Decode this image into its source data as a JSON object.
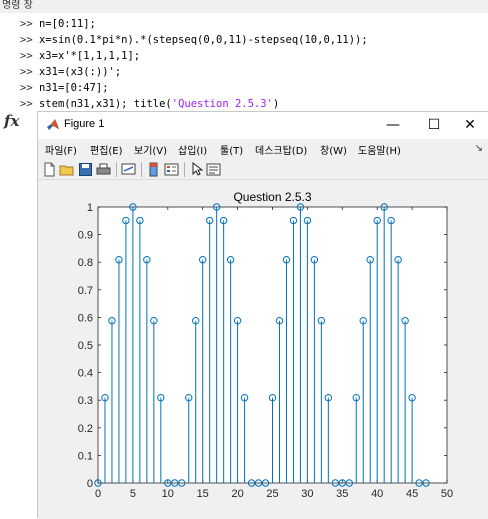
{
  "command_window": {
    "title": "명령 창",
    "prompt": ">>",
    "lines": [
      {
        "code": "n=[0:11];",
        "str": "",
        "tail": ""
      },
      {
        "code": "x=sin(0.1*pi*n).*(stepseq(0,0,11)-stepseq(10,0,11));",
        "str": "",
        "tail": ""
      },
      {
        "code": "x3=x'*[1,1,1,1];",
        "str": "",
        "tail": ""
      },
      {
        "code": "x31=(x3(:))';",
        "str": "",
        "tail": ""
      },
      {
        "code": "n31=[0:47];",
        "str": "",
        "tail": ""
      },
      {
        "code": "stem(n31,x31); title(",
        "str": "'Question 2.5.3'",
        "tail": ")"
      }
    ],
    "fx_symbol": "fx"
  },
  "figure": {
    "title": "Figure 1",
    "window_buttons": {
      "minimize": "—",
      "maximize": "☐",
      "close": "✕"
    },
    "menu": [
      "파일(F)",
      "편집(E)",
      "보기(V)",
      "삽입(I)",
      "툴(T)",
      "데스크탑(D)",
      "창(W)",
      "도움말(H)"
    ],
    "menu_overflow": "↘",
    "toolbar_icons": [
      "new-figure-icon",
      "open-file-icon",
      "save-icon",
      "print-icon",
      "link-plot-icon",
      "insert-colorbar-icon",
      "insert-legend-icon",
      "pointer-icon",
      "edit-plot-icon"
    ],
    "colors": {
      "stem": "#0072bd",
      "axes_bg": "#ffffff",
      "figure_bg": "#f0f0f0",
      "string": "#a020f0"
    }
  },
  "chart_data": {
    "type": "stem",
    "title": "Question 2.5.3",
    "xlabel": "",
    "ylabel": "",
    "xlim": [
      0,
      50
    ],
    "ylim": [
      0,
      1
    ],
    "xticks": [
      0,
      5,
      10,
      15,
      20,
      25,
      30,
      35,
      40,
      45,
      50
    ],
    "yticks": [
      0,
      0.1,
      0.2,
      0.3,
      0.4,
      0.5,
      0.6,
      0.7,
      0.8,
      0.9,
      1
    ],
    "ytick_labels": [
      "0",
      "0.1",
      "0.2",
      "0.3",
      "0.4",
      "0.5",
      "0.6",
      "0.7",
      "0.8",
      "0.9",
      "1"
    ],
    "x": [
      0,
      1,
      2,
      3,
      4,
      5,
      6,
      7,
      8,
      9,
      10,
      11,
      12,
      13,
      14,
      15,
      16,
      17,
      18,
      19,
      20,
      21,
      22,
      23,
      24,
      25,
      26,
      27,
      28,
      29,
      30,
      31,
      32,
      33,
      34,
      35,
      36,
      37,
      38,
      39,
      40,
      41,
      42,
      43,
      44,
      45,
      46,
      47
    ],
    "values": [
      0,
      0.309,
      0.588,
      0.809,
      0.951,
      1,
      0.951,
      0.809,
      0.588,
      0.309,
      0,
      0,
      0,
      0.309,
      0.588,
      0.809,
      0.951,
      1,
      0.951,
      0.809,
      0.588,
      0.309,
      0,
      0,
      0,
      0.309,
      0.588,
      0.809,
      0.951,
      1,
      0.951,
      0.809,
      0.588,
      0.309,
      0,
      0,
      0,
      0.309,
      0.588,
      0.809,
      0.951,
      1,
      0.951,
      0.809,
      0.588,
      0.309,
      0,
      0
    ]
  }
}
